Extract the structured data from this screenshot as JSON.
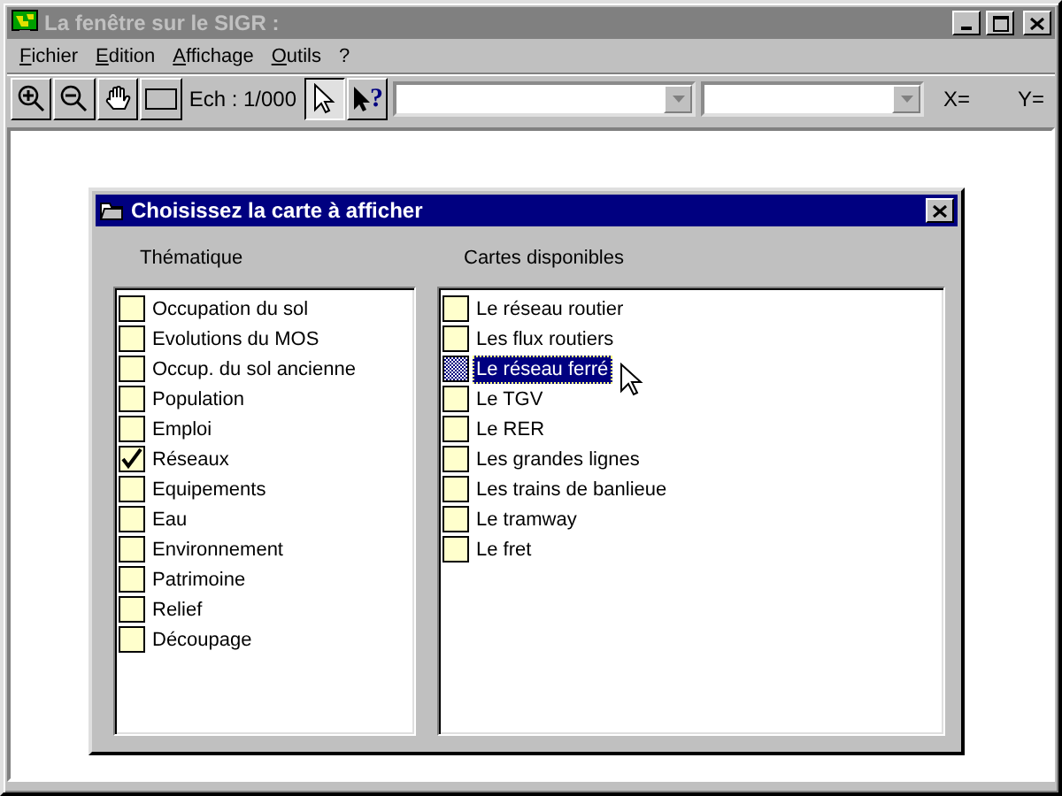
{
  "window": {
    "title": "La fenêtre sur le SIGR :"
  },
  "menu": [
    {
      "label": "Fichier"
    },
    {
      "label": "Edition"
    },
    {
      "label": "Affichage"
    },
    {
      "label": "Outils"
    },
    {
      "label": "?"
    }
  ],
  "toolbar": {
    "tools": [
      {
        "kind": "zoom-in",
        "selected": false
      },
      {
        "kind": "zoom-out",
        "selected": false
      },
      {
        "kind": "pan",
        "selected": false
      },
      {
        "kind": "frame",
        "selected": false
      }
    ],
    "scale": "Ech : 1/000",
    "modes": [
      {
        "kind": "pointer",
        "selected": true
      },
      {
        "kind": "help",
        "glyph": "?",
        "selected": false
      }
    ],
    "x_label": "X=",
    "y_label": "Y="
  },
  "dialog": {
    "title": "Choisissez la carte à afficher",
    "themes": {
      "heading": "Thématique",
      "items": [
        {
          "label": "Occupation du sol",
          "checked": false
        },
        {
          "label": "Evolutions du MOS",
          "checked": false
        },
        {
          "label": "Occup. du sol ancienne",
          "checked": false
        },
        {
          "label": "Population",
          "checked": false
        },
        {
          "label": "Emploi",
          "checked": false
        },
        {
          "label": "Réseaux",
          "checked": true
        },
        {
          "label": "Equipements",
          "checked": false
        },
        {
          "label": "Eau",
          "checked": false
        },
        {
          "label": "Environnement",
          "checked": false
        },
        {
          "label": "Patrimoine",
          "checked": false
        },
        {
          "label": "Relief",
          "checked": false
        },
        {
          "label": "Découpage",
          "checked": false
        }
      ]
    },
    "maps": {
      "heading": "Cartes disponibles",
      "items": [
        {
          "label": "Le réseau routier",
          "selected": false
        },
        {
          "label": "Les flux routiers",
          "selected": false
        },
        {
          "label": "Le réseau ferré",
          "selected": true
        },
        {
          "label": "Le TGV",
          "selected": false
        },
        {
          "label": "Le RER",
          "selected": false
        },
        {
          "label": "Les grandes lignes",
          "selected": false
        },
        {
          "label": "Les trains de banlieue",
          "selected": false
        },
        {
          "label": "Le tramway",
          "selected": false
        },
        {
          "label": "Le fret",
          "selected": false
        }
      ]
    }
  }
}
